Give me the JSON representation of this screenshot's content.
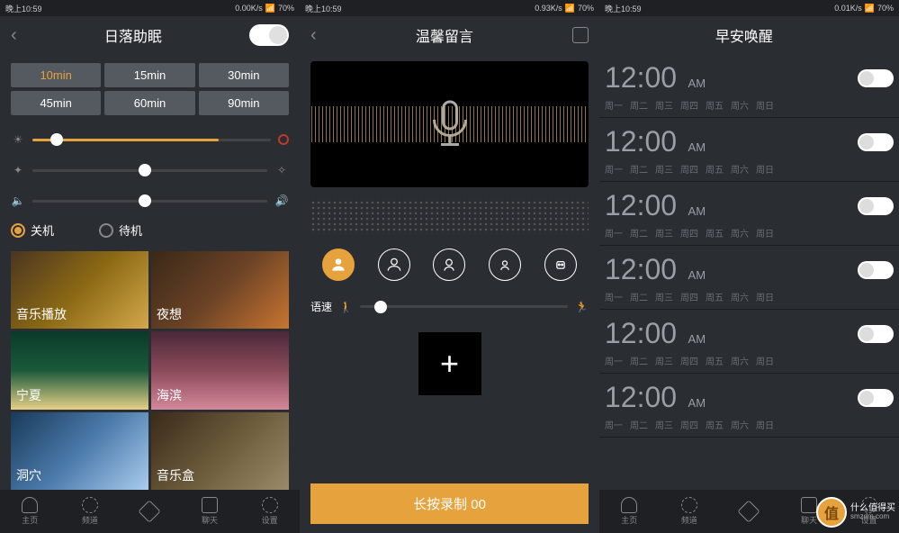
{
  "status_bar": {
    "time": "晚上10:59",
    "net_speed": [
      "0.00K/s",
      "0.93K/s",
      "0.01K/s"
    ],
    "battery": "70%"
  },
  "screen1": {
    "title": "日落助眠",
    "durations": [
      "10min",
      "15min",
      "30min",
      "45min",
      "60min",
      "90min"
    ],
    "radio1": "关机",
    "radio2": "待机",
    "tiles": [
      "音乐播放",
      "夜想",
      "宁夏",
      "海滨",
      "洞穴",
      "音乐盒"
    ]
  },
  "screen2": {
    "title": "温馨留言",
    "speed_label": "语速",
    "record_label": "长按录制 00"
  },
  "screen3": {
    "title": "早安唤醒",
    "alarms": [
      {
        "time": "12:00",
        "ampm": "AM"
      },
      {
        "time": "12:00",
        "ampm": "AM"
      },
      {
        "time": "12:00",
        "ampm": "AM"
      },
      {
        "time": "12:00",
        "ampm": "AM"
      },
      {
        "time": "12:00",
        "ampm": "AM"
      },
      {
        "time": "12:00",
        "ampm": "AM"
      }
    ],
    "days": [
      "周一",
      "周二",
      "周三",
      "周四",
      "周五",
      "周六",
      "周日"
    ]
  },
  "nav": {
    "items": [
      "主页",
      "频道",
      "",
      "聊天",
      "设置"
    ]
  },
  "watermark": {
    "badge": "值",
    "line1": "什么值得买",
    "line2": "smzdm.com"
  }
}
